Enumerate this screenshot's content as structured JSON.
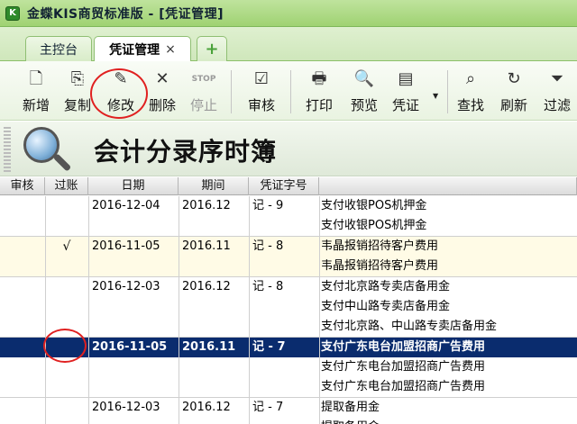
{
  "app": {
    "title": "金蝶KIS商贸标准版 - [凭证管理]"
  },
  "tabs": [
    {
      "label": "主控台",
      "active": false
    },
    {
      "label": "凭证管理",
      "active": true,
      "close": "×"
    },
    {
      "label": "+",
      "active": false
    }
  ],
  "toolbar": {
    "buttons": [
      {
        "label": "新增",
        "icon": "new-doc-icon",
        "glyph": "🗋",
        "disabled": false
      },
      {
        "label": "复制",
        "icon": "copy-icon",
        "glyph": "⎘",
        "disabled": false
      },
      {
        "label": "修改",
        "icon": "edit-icon",
        "glyph": "✎",
        "disabled": false
      },
      {
        "label": "删除",
        "icon": "delete-icon",
        "glyph": "✕",
        "disabled": false
      },
      {
        "label": "停止",
        "icon": "stop-icon",
        "glyph": "STOP",
        "disabled": true
      },
      {
        "label": "审核",
        "icon": "audit-icon",
        "glyph": "☑",
        "disabled": false
      },
      {
        "label": "打印",
        "icon": "print-icon",
        "glyph": "🖶",
        "disabled": false
      },
      {
        "label": "预览",
        "icon": "preview-icon",
        "glyph": "🔍",
        "disabled": false
      },
      {
        "label": "凭证",
        "icon": "voucher-icon",
        "glyph": "▤",
        "disabled": false
      },
      {
        "label": "查找",
        "icon": "find-icon",
        "glyph": "⌕",
        "disabled": false
      },
      {
        "label": "刷新",
        "icon": "refresh-icon",
        "glyph": "↻",
        "disabled": false
      },
      {
        "label": "过滤",
        "icon": "filter-icon",
        "glyph": "⏷",
        "disabled": false
      }
    ]
  },
  "header": {
    "title": "会计分录序时簿"
  },
  "table": {
    "columns": [
      "审核",
      "过账",
      "日期",
      "期间",
      "凭证字号",
      ""
    ],
    "entries": [
      {
        "audit": "",
        "posted": "",
        "date": "2016-12-04",
        "period": "2016.12",
        "voucher": "记 - 9",
        "summaries": [
          "支付收银POS机押金",
          "支付收银POS机押金"
        ],
        "selected": false,
        "alt": false
      },
      {
        "audit": "",
        "posted": "√",
        "date": "2016-11-05",
        "period": "2016.11",
        "voucher": "记 - 8",
        "summaries": [
          "韦晶报销招待客户费用",
          "韦晶报销招待客户费用"
        ],
        "selected": false,
        "alt": true
      },
      {
        "audit": "",
        "posted": "",
        "date": "2016-12-03",
        "period": "2016.12",
        "voucher": "记 - 8",
        "summaries": [
          "支付北京路专卖店备用金",
          "支付中山路专卖店备用金",
          "支付北京路、中山路专卖店备用金"
        ],
        "selected": false,
        "alt": false
      },
      {
        "audit": "",
        "posted": "",
        "date": "2016-11-05",
        "period": "2016.11",
        "voucher": "记 - 7",
        "summaries": [
          "支付广东电台加盟招商广告费用",
          "支付广东电台加盟招商广告费用",
          "支付广东电台加盟招商广告费用"
        ],
        "selected": true,
        "alt": false
      },
      {
        "audit": "",
        "posted": "",
        "date": "2016-12-03",
        "period": "2016.12",
        "voucher": "记 - 7",
        "summaries": [
          "提取备用金",
          "提取备用金"
        ],
        "selected": false,
        "alt": false
      }
    ]
  },
  "colors": {
    "titlebar": "#9fd272",
    "selected_row": "#0a2c6e",
    "annotation": "#e02020"
  }
}
